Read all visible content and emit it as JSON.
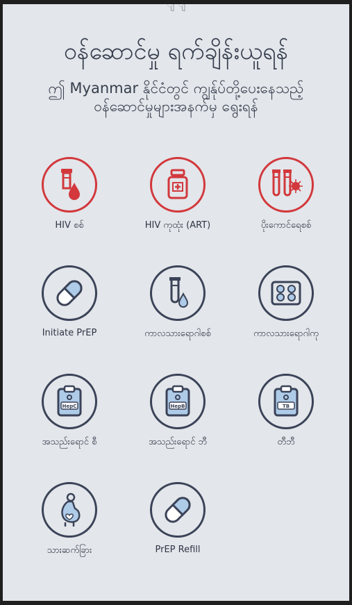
{
  "header": {
    "cut_text": "ျ ျ",
    "title": "ဝန်ဆောင်မှု ရက်ချိန်းယူရန်",
    "subtitle": "ဤ Myanmar နိုင်ငံတွင် ကျွန်ုပ်တို့ပေးနေသည့် ဝန်ဆောင်မှုများအနက်မှ ရွေးရန်"
  },
  "services": [
    {
      "label": "HIV စစ်",
      "icon": "blood-tube-drop-icon",
      "accent": "#d2383c"
    },
    {
      "label": "HIV ကုထုံး (ART)",
      "icon": "medicine-bottle-icon",
      "accent": "#d2383c"
    },
    {
      "label": "ပိုးကောင်ရေစစ်",
      "icon": "test-tubes-virus-icon",
      "accent": "#d2383c"
    },
    {
      "label": "Initiate PrEP",
      "icon": "pill-capsule-icon",
      "accent": "#3b4358"
    },
    {
      "label": "ကာလသားရောဂါစစ်",
      "icon": "tube-drop-icon",
      "accent": "#3b4358"
    },
    {
      "label": "ကာလသားရောဂါကု",
      "icon": "pill-blister-icon",
      "accent": "#3b4358"
    },
    {
      "label": "အသည်းရောင် စီ",
      "icon": "clipboard-hepc-icon",
      "accent": "#3b4358",
      "badge": "HepC"
    },
    {
      "label": "အသည်းရောင် ဘီ",
      "icon": "clipboard-hepb-icon",
      "accent": "#3b4358",
      "badge": "HepB"
    },
    {
      "label": "တီဘီ",
      "icon": "clipboard-tb-icon",
      "accent": "#3b4358",
      "badge": "TB"
    },
    {
      "label": "သားဆက်ခြား",
      "icon": "pregnancy-icon",
      "accent": "#3b4358"
    },
    {
      "label": "PrEP Refill",
      "icon": "pill-capsule-icon",
      "accent": "#3b4358"
    }
  ]
}
